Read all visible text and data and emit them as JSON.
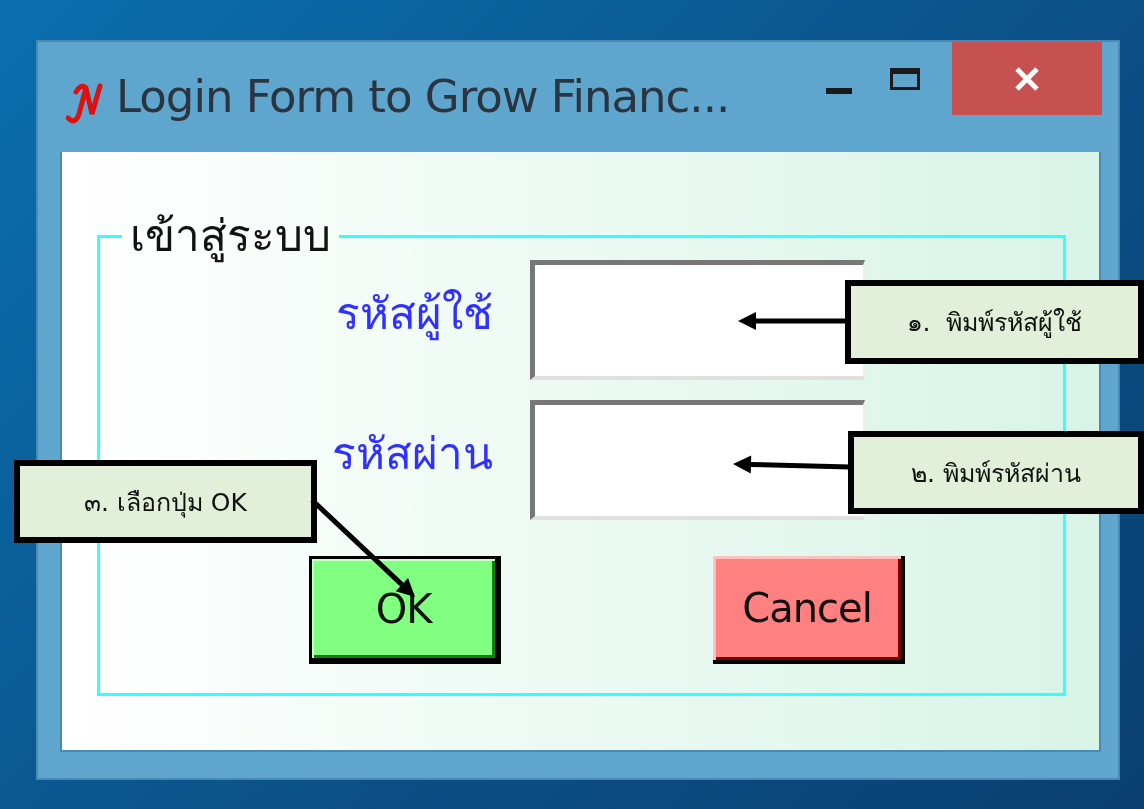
{
  "window": {
    "title": "Login Form to Grow Financ..."
  },
  "group": {
    "title": "เข้าสู่ระบบ",
    "fields": [
      {
        "label": "รหัสผู้ใช้"
      },
      {
        "label": "รหัสผ่าน"
      }
    ],
    "buttons": [
      {
        "label": "OK",
        "kind": "ok"
      },
      {
        "label": "Cancel",
        "kind": "cancel"
      }
    ]
  },
  "callouts": [
    {
      "text": "๑.  พิมพ์รหัสผู้ใช้"
    },
    {
      "text": "๒. พิมพ์รหัสผ่าน"
    },
    {
      "text": "๓. เลือกปุ่ม OK"
    }
  ]
}
